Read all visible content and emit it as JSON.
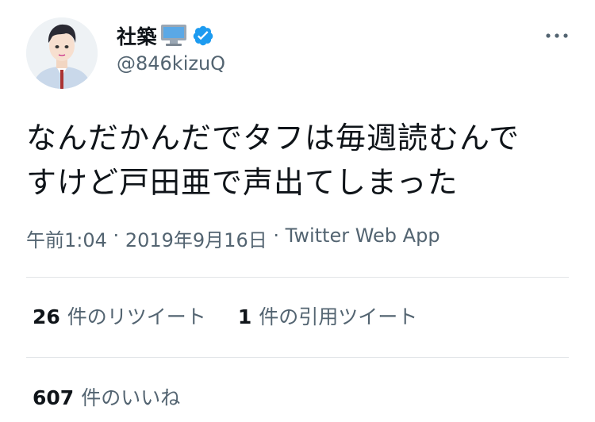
{
  "tweet": {
    "display_name": "社築",
    "pc_icon": "desktop-computer-icon",
    "verified_icon": "verified-badge-icon",
    "handle": "@846kizuQ",
    "text": "なんだかんだでタフは毎週読むんで\nすけど戸田亜で声出てしまった",
    "time": "午前1:04",
    "separator": "·",
    "date": "2019年9月16日",
    "source": "Twitter Web App"
  },
  "stats": {
    "retweets_count": "26",
    "retweets_label": "件のリツイート",
    "quotes_count": "1",
    "quotes_label": "件の引用ツイート",
    "likes_count": "607",
    "likes_label": "件のいいね"
  },
  "colors": {
    "text": "#0f1419",
    "secondary": "#536471",
    "verified": "#1d9bf0",
    "divider": "#e1e4e7"
  }
}
